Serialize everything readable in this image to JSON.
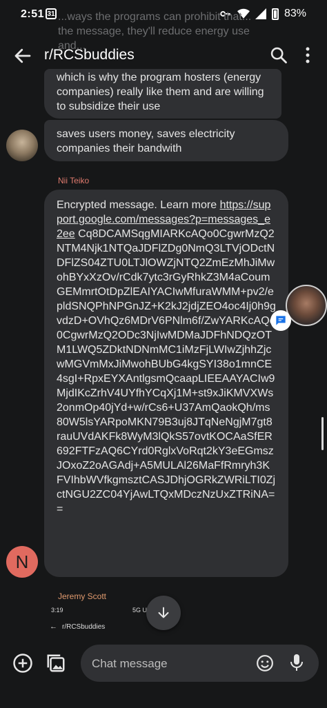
{
  "status_bar": {
    "time": "2:51",
    "calendar_day": "31",
    "battery": "83%"
  },
  "app_bar": {
    "title": "r/RCSbuddies"
  },
  "ghost_text": "...ways the programs can prohibit that...\nthe message, they'll reduce energy use and...",
  "messages": [
    {
      "text": "which is why the program hosters (energy companies) really like them and are willing to subsidize their use"
    },
    {
      "text": "saves users money, saves electricity companies their bandwith"
    },
    {
      "sender": "Nii Teiko",
      "text_prefix": "Encrypted message. Learn more ",
      "link": "https://support.google.com/messages?p=messages_e2ee",
      "text_suffix": " Cq8DCAMSqgMIARKcAQo0CgwrMzQ2NTM4Njk1NTQaJDFlZDg0NmQ3LTVjODctNDFlZS04ZTU0LTJlOWZjNTQ2ZmEzMhJiMwohBYxXzOv/rCdk7ytc3rGyRhkZ3M4aCoumGEMmrtOtDpZlEAIYACIwMfuraWMM+pv2/epldSNQPhNPGnJZ+K2kJ2jdjZEO4oc4Ij0h9gvdzD+OVhQz6MDrV6PNlm6f/ZwYARKcAQo0CgwrMzQ2ODc3NjIwMDMaJDFhNDQzOTM1LWQ5ZDktNDNmMC1iMzFjLWIwZjhhZjcwMGVmMxJiMwohBUbG4kgSYI38o1mnCE4sgI+RpxEYXAntlgsmQcaapLIEEAAYACIw9MjdIKcZrhV4UYfhYCqXj1M+st9xJiKMVXWs2onmOp40jYd+w/rCs6+U37AmQaokQh/ms80W5lsYARpoMKN79B3uj8JTqNeNgjM7gt8rauUVdAKFk8WyM3lQkS57ovtKOCAaSfER692FTFzAQ6CYrd0RglxVoRqt2kY3eEGmszJOxoZ2oAGAdj+A5MULAl26MaFfRmryh3KFVIhbWVfkgmsztCASJDhjOGRkZWRiLTI0ZjctNGU2ZC04YjAwLTQxMDczNzUxZTRiNA=="
    }
  ],
  "next_sender": "Jeremy Scott",
  "preview": {
    "time": "3:19",
    "signal": "5G UC",
    "title": "r/RCSbuddies"
  },
  "composer": {
    "placeholder": "Chat message"
  },
  "avatars": {
    "n_initial": "N"
  },
  "icons": {
    "back": "arrow-left",
    "search": "magnifier",
    "more": "vertical-dots",
    "add": "plus-circle",
    "gallery": "image-stack",
    "emoji": "smiley",
    "mic": "microphone",
    "scroll_down": "arrow-down",
    "chat_badge": "chat-bubble"
  }
}
